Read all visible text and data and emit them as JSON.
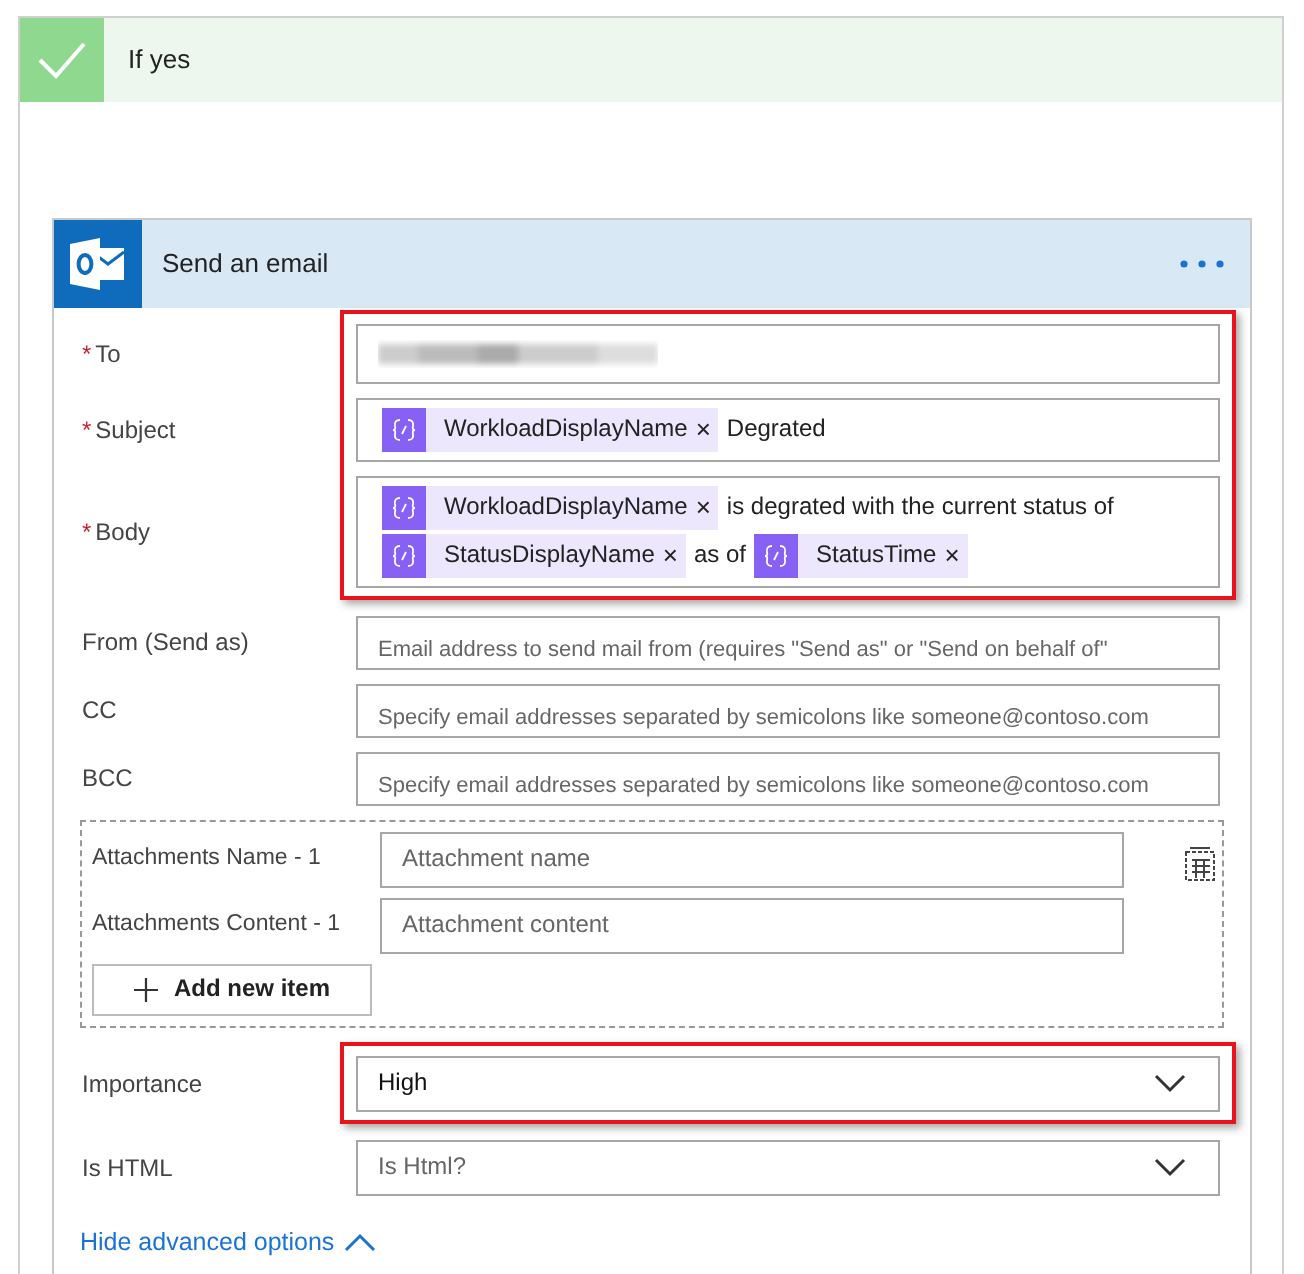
{
  "branch": {
    "title": "If yes"
  },
  "action": {
    "title": "Send an email"
  },
  "groups": [
    {
      "highlighted": true,
      "fields": [
        {
          "kind": "redacted",
          "label": "To",
          "required_mark": "*"
        },
        {
          "kind": "tokens",
          "label": "Subject",
          "required_mark": "*",
          "lines": [
            [
              {
                "kind": "token",
                "text": "WorkloadDisplayName",
                "remove": "×"
              },
              {
                "kind": "text",
                "text": "Degrated"
              }
            ]
          ]
        },
        {
          "kind": "tokens",
          "label": "Body",
          "required_mark": "*",
          "lines": [
            [
              {
                "kind": "token",
                "text": "WorkloadDisplayName",
                "remove": "×"
              },
              {
                "kind": "text",
                "text": "is degrated with the current status of"
              }
            ],
            [
              {
                "kind": "token",
                "text": "StatusDisplayName",
                "remove": "×"
              },
              {
                "kind": "text",
                "text": "as of"
              },
              {
                "kind": "token",
                "text": "StatusTime",
                "remove": "×"
              }
            ]
          ]
        }
      ]
    },
    {
      "highlighted": false,
      "fields": [
        {
          "kind": "text",
          "label": "From (Send as)",
          "placeholder": "Email address to send mail from (requires \"Send as\" or \"Send on behalf of\""
        },
        {
          "kind": "text",
          "label": "CC",
          "placeholder": "Specify email addresses separated by semicolons like someone@contoso.com"
        },
        {
          "kind": "text",
          "label": "BCC",
          "placeholder": "Specify email addresses separated by semicolons like someone@contoso.com"
        }
      ]
    },
    {
      "kind": "attachments",
      "rows": [
        {
          "label": "Attachments Name - 1",
          "placeholder": "Attachment name"
        },
        {
          "label": "Attachments Content - 1",
          "placeholder": "Attachment content"
        }
      ],
      "add_button": "Add new item"
    },
    {
      "highlighted": true,
      "fields": [
        {
          "kind": "select",
          "label": "Importance",
          "value": "High"
        }
      ]
    },
    {
      "highlighted": false,
      "fields": [
        {
          "kind": "select",
          "label": "Is HTML",
          "placeholder": "Is Html?"
        }
      ]
    }
  ],
  "advanced_link": {
    "text": "Hide advanced options",
    "expanded": true
  }
}
